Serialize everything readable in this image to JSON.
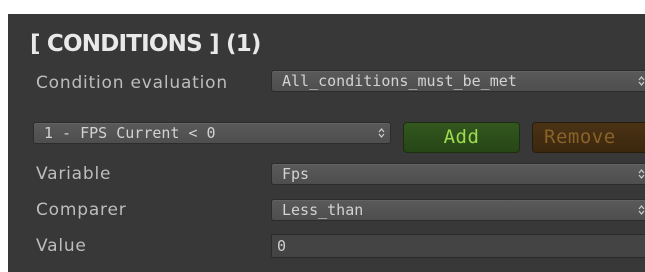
{
  "header": {
    "title": "[ CONDITIONS ] (1)"
  },
  "evaluation": {
    "label": "Condition evaluation",
    "value": "All_conditions_must_be_met"
  },
  "condition_selector": {
    "value": "1 - FPS Current < 0"
  },
  "buttons": {
    "add_label": "Add",
    "remove_label": "Remove"
  },
  "fields": {
    "variable_label": "Variable",
    "variable_value": "Fps",
    "comparer_label": "Comparer",
    "comparer_value": "Less_than",
    "value_label": "Value",
    "value_value": "0"
  },
  "icons": {
    "dropdown_arrows": "up-down-chevron-icon"
  },
  "colors": {
    "panel_background": "#383838",
    "add_button": "#2c4f1a",
    "add_text": "#9edb4e",
    "remove_button": "#432d12",
    "remove_text": "#8a6228"
  }
}
